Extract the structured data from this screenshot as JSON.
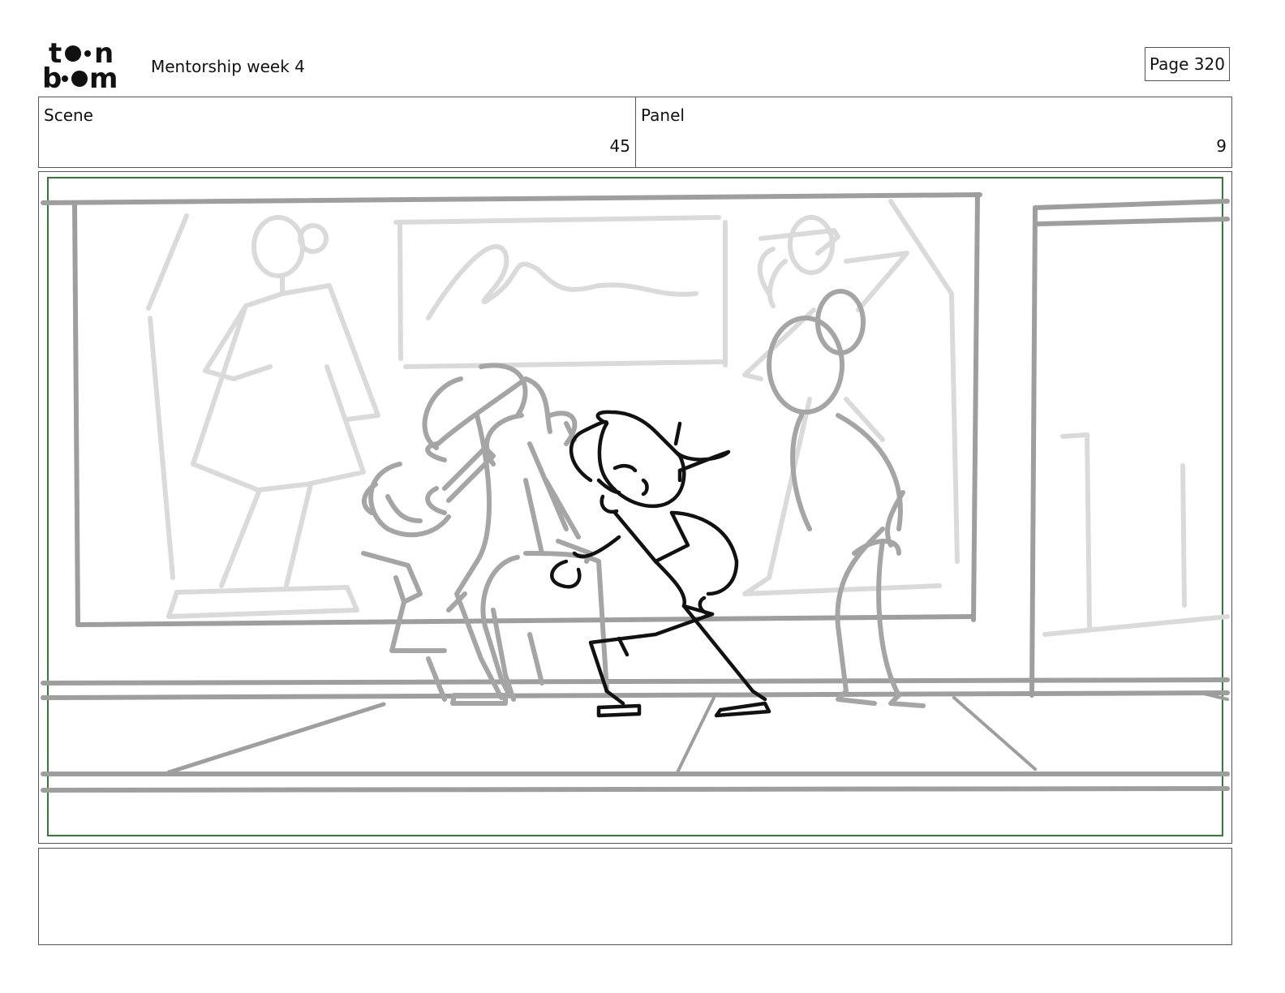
{
  "header": {
    "logo_line1": "toon",
    "logo_line2": "boom",
    "document_title": "Mentorship week 4",
    "page_label": "Page 320"
  },
  "scene": {
    "label": "Scene",
    "value": "45"
  },
  "panel": {
    "label": "Panel",
    "value": "9"
  },
  "colors": {
    "safe_frame": "#2e7d32",
    "sketch_light": "#d9d9d9",
    "sketch_mid": "#a3a3a3",
    "sketch_ink": "#111111"
  },
  "notes": {
    "text": ""
  }
}
